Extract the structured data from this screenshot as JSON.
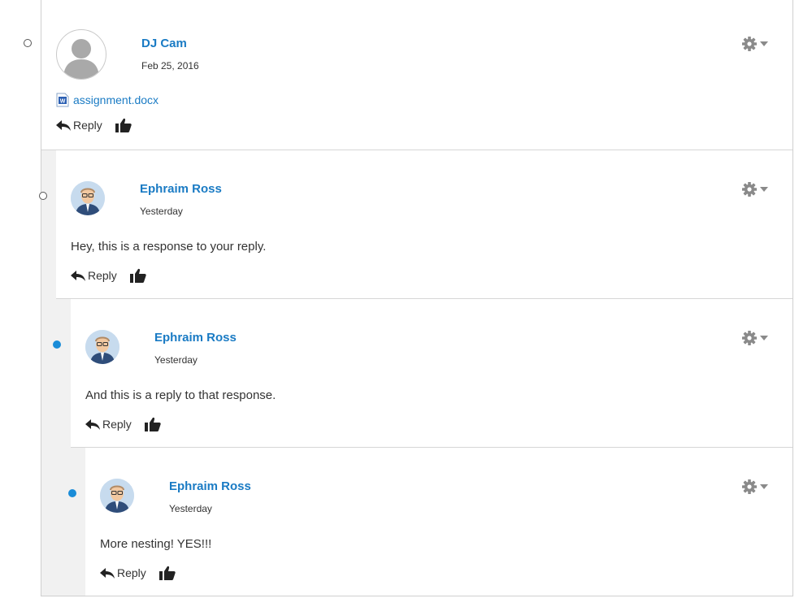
{
  "colors": {
    "link": "#1a7bc4",
    "unread_marker": "#1a8cd8",
    "thread_background": "#f1f1f1"
  },
  "comments": [
    {
      "author": "DJ Cam",
      "date": "Feb 25, 2016",
      "avatar": "default-user-icon",
      "marker": "read",
      "attachment": "assignment.docx",
      "body": "",
      "reply_label": "Reply"
    },
    {
      "author": "Ephraim Ross",
      "date": "Yesterday",
      "avatar": "user-photo",
      "marker": "read",
      "body": "Hey, this is a response to your reply.",
      "reply_label": "Reply"
    },
    {
      "author": "Ephraim Ross",
      "date": "Yesterday",
      "avatar": "user-photo",
      "marker": "unread",
      "body": "And this is a reply to that response.",
      "reply_label": "Reply"
    },
    {
      "author": "Ephraim Ross",
      "date": "Yesterday",
      "avatar": "user-photo",
      "marker": "unread",
      "body": "More nesting! YES!!!",
      "reply_label": "Reply"
    }
  ]
}
